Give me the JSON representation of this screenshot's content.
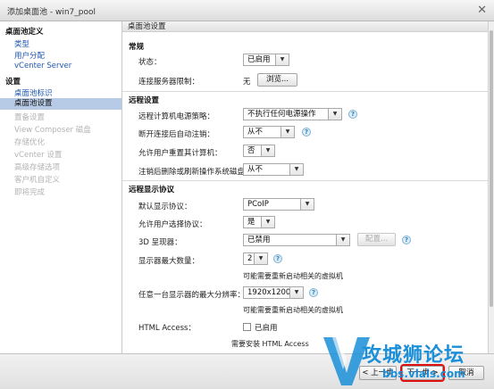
{
  "window": {
    "title": "添加桌面池 - win7_pool",
    "close_glyph": "✕"
  },
  "sidebar": {
    "group1": "桌面池定义",
    "items1": [
      {
        "label": "类型",
        "state": "link"
      },
      {
        "label": "用户分配",
        "state": "link"
      },
      {
        "label": "vCenter Server",
        "state": "link"
      }
    ],
    "group2": "设置",
    "items2": [
      {
        "label": "桌面池标识",
        "state": "link"
      },
      {
        "label": "桌面池设置",
        "state": "selected"
      },
      {
        "label": "置备设置",
        "state": "disabled"
      },
      {
        "label": "View Composer 磁盘",
        "state": "disabled"
      },
      {
        "label": "存储优化",
        "state": "disabled"
      },
      {
        "label": "vCenter 设置",
        "state": "disabled"
      },
      {
        "label": "高级存储选项",
        "state": "disabled"
      },
      {
        "label": "客户机自定义",
        "state": "disabled"
      },
      {
        "label": "即将完成",
        "state": "disabled"
      }
    ]
  },
  "main": {
    "header": "桌面池设置",
    "general": {
      "title": "常规",
      "state_label": "状态：",
      "state_value": "已启用",
      "conn_label": "连接服务器限制：",
      "conn_value": "无",
      "browse_button": "浏览..."
    },
    "remote": {
      "title": "远程设置",
      "power_label": "远程计算机电源策略：",
      "power_value": "不执行任何电源操作",
      "logoff_label": "断开连接后自动注销：",
      "logoff_value": "从不",
      "reset_label": "允许用户重置其计算机：",
      "reset_value": "否",
      "delete_label": "注销后删除或刷新操作系统磁盘：",
      "delete_value": "从不"
    },
    "display": {
      "title": "远程显示协议",
      "proto_label": "默认显示协议：",
      "proto_value": "PCoIP",
      "choose_label": "允许用户选择协议：",
      "choose_value": "是",
      "render_label": "3D 呈现器：",
      "render_value": "已禁用",
      "config_button": "配置...",
      "monitors_label": "显示器最大数量：",
      "monitors_value": "2",
      "restart_note1": "可能需要重新启动相关的虚拟机",
      "res_label": "任意一台显示器的最大分辨率：",
      "res_value": "1920x1200",
      "restart_note2": "可能需要重新启动相关的虚拟机",
      "html_label": "HTML Access：",
      "html_check": "已启用",
      "html_note": "需要安装 HTML Access"
    },
    "help_glyph": "?"
  },
  "footer": {
    "back_button": "< 上一步",
    "next_button": "下一步 >",
    "cancel_button": "取消"
  },
  "watermark": {
    "text": "攻城狮论坛",
    "url": "bbs.vlais.com"
  },
  "colors": {
    "link": "#1f57b0",
    "selected_bg": "#b7cbe6",
    "accent_red": "#e01010",
    "watermark": "#1b8fd8"
  }
}
